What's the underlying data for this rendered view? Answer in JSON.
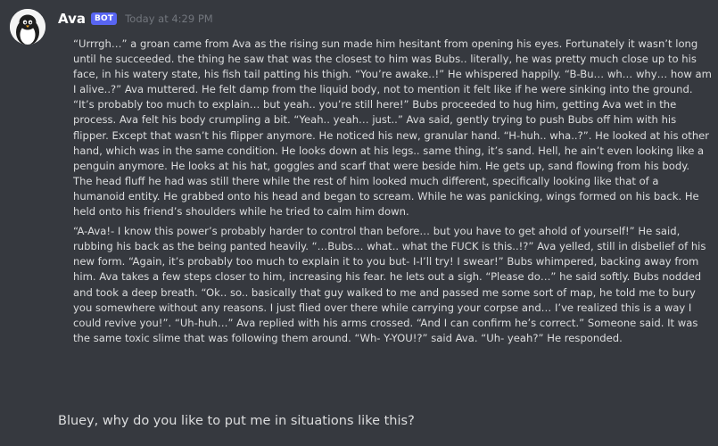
{
  "message": {
    "author": "Ava",
    "bot_tag": "BOT",
    "timestamp": "Today at 4:29 PM",
    "paragraphs": [
      "“Urrrgh…” a groan came from Ava as the rising sun made him hesitant from opening his eyes. Fortunately it wasn’t long until he succeeded. the thing he saw that was the closest to him was Bubs.. literally, he was pretty much close up to his face, in his watery state, his fish tail patting his thigh. “You’re awake..!” He whispered happily. “B-Bu… wh… why… how am I alive..?” Ava muttered. He felt damp from the liquid body, not to mention it felt like if he were sinking into the ground. “It’s probably too much to explain… but yeah.. you’re still here!” Bubs proceeded to hug him, getting Ava wet in the process. Ava felt his body crumpling a bit. “Yeah.. yeah… just..” Ava said, gently trying to push Bubs off him with his flipper. Except that wasn’t his flipper anymore. He noticed his new, granular hand. “H-huh.. wha..?”. He looked at his other hand, which was in the same condition. He looks down at his legs.. same thing, it’s sand. Hell, he ain’t even looking like a penguin anymore. He looks at his hat, goggles and scarf that were beside him. He gets up, sand flowing from his body. The head fluff he had was still there while the rest of him looked much different, specifically looking like that of a humanoid entity. He grabbed onto his head and began to scream. While he was panicking, wings formed on his back. He held onto his friend’s shoulders while he tried to calm him down.",
      "“A-Ava!- I know this power’s probably harder to control than before… but you have to get ahold of yourself!” He said, rubbing his back as the being panted heavily. “…Bubs… what.. what the FUCK is this..!?” Ava yelled, still in disbelief of his new form. “Again, it’s probably too much to explain it to you but- I-I’ll try! I swear!” Bubs whimpered, backing away from him. Ava takes a few steps closer to him, increasing his fear. he lets out a sigh. “Please do…” he said softly. Bubs nodded and took a deep breath. “Ok.. so.. basically that guy walked to me and passed me some sort of map, he told me to bury you somewhere without any reasons. I just flied over there while carrying your corpse and… I’ve realized this is a way I could revive you!”. “Uh-huh…” Ava replied with his arms crossed. “And I can confirm he’s correct.” Someone said. It was the same toxic slime that was following them around. “Wh- Y-YOU!?” said Ava. “Uh- yeah?” He responded."
    ]
  },
  "reply": {
    "text": "Bluey, why do you like to put me in situations like this?"
  },
  "icons": {
    "avatar": "penguin-avatar-icon"
  },
  "colors": {
    "background": "#36393f",
    "username": "#ffffff",
    "bot_badge": "#5865f2",
    "timestamp": "#72767d",
    "text": "#dcddde"
  }
}
